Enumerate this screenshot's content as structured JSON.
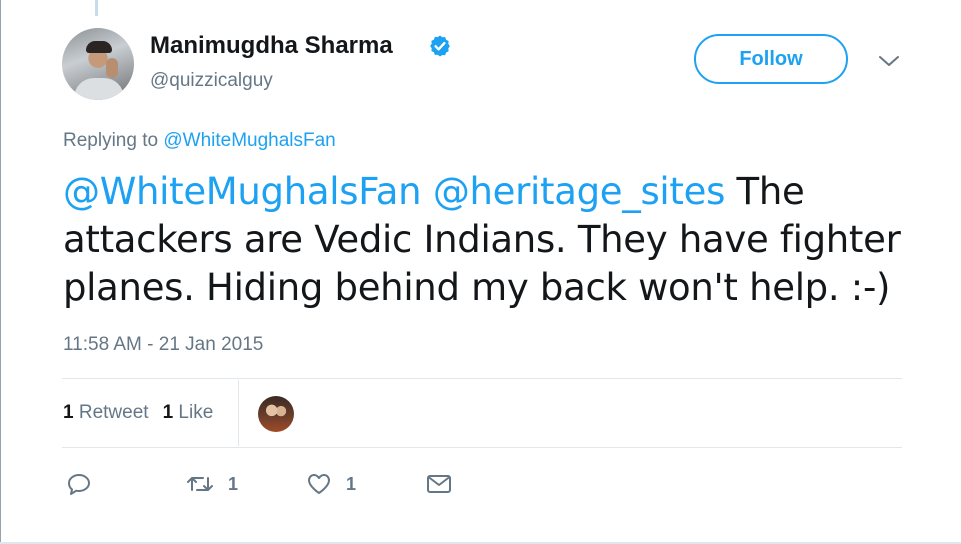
{
  "author": {
    "display_name": "Manimugdha Sharma",
    "handle": "@quizzicalguy",
    "verified": true
  },
  "follow_label": "Follow",
  "reply_context": {
    "prefix": "Replying to",
    "mention": "@WhiteMughalsFan"
  },
  "tweet": {
    "mention_1": "@WhiteMughalsFan",
    "mention_2": "@heritage_sites",
    "line_1_text": " The",
    "line_2": "attackers are Vedic Indians. They have fighter",
    "line_3": "planes. Hiding behind my back won't help. :-)"
  },
  "timestamp": "11:58 AM - 21 Jan 2015",
  "stats": {
    "retweet_count": "1",
    "retweet_label": "Retweet",
    "like_count": "1",
    "like_label": "Like"
  },
  "actions": {
    "reply_icon": "reply-icon",
    "retweet_icon": "retweet-icon",
    "retweet_count": "1",
    "like_icon": "heart-icon",
    "like_count": "1",
    "dm_icon": "envelope-icon"
  },
  "colors": {
    "accent": "#1da1f2",
    "text": "#14171a",
    "secondary": "#657786",
    "border": "#e1e8ed"
  }
}
